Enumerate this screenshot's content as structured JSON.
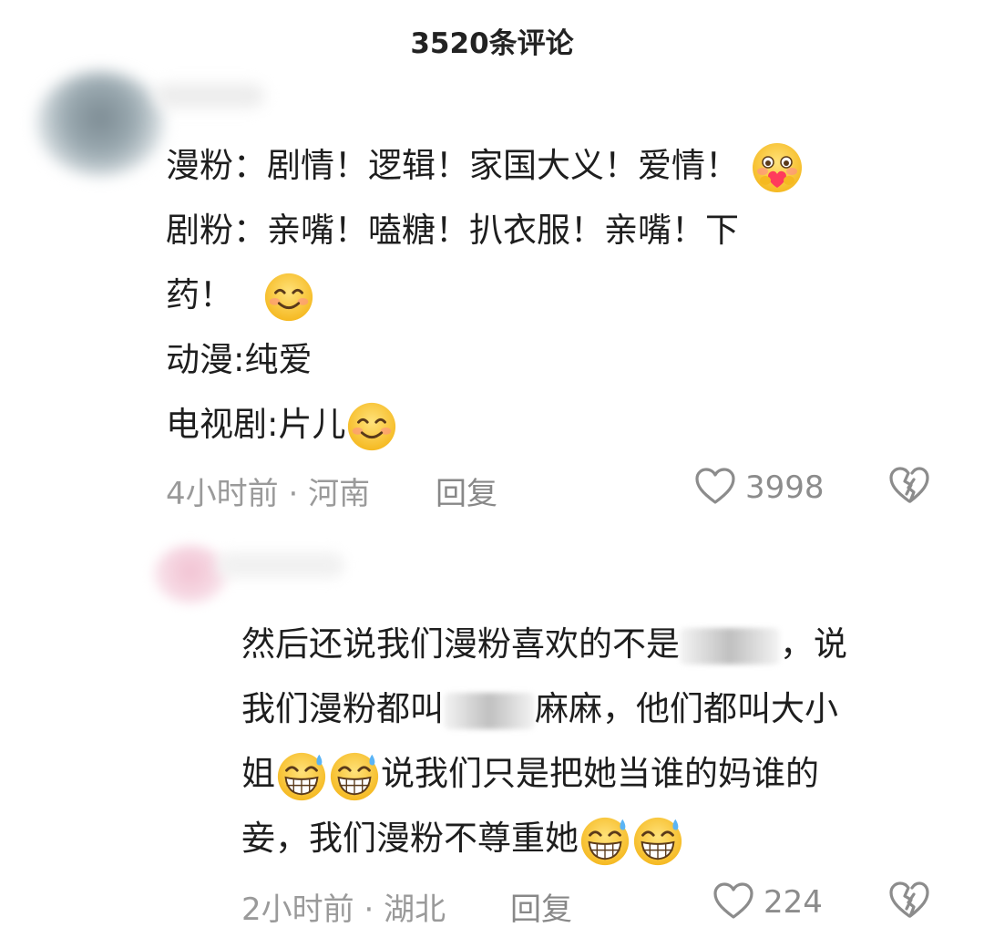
{
  "header": {
    "title": "3520条评论"
  },
  "comments": [
    {
      "lines": [
        "漫粉：剧情！逻辑！家国大义！爱情！",
        "剧粉：亲嘴！嗑糖！扒衣服！亲嘴！下",
        "药！",
        "动漫:纯爱",
        "电视剧:片儿"
      ],
      "time": "4小时前",
      "separator": "·",
      "location": "河南",
      "reply_label": "回复",
      "likes": "3998",
      "emojis": [
        "heart-hug-emoji-icon",
        "smile-emoji-icon",
        "smile-emoji-icon"
      ]
    },
    {
      "line1": "然后还说我们漫粉喜欢的不是",
      "line1_tail": "，说",
      "line2a": "我们漫粉都叫",
      "line2b": "麻麻，他们都叫大小",
      "line3a": "姐",
      "line3b": "说我们只是把她当谁的妈谁的",
      "line4": "妾，我们漫粉不尊重她",
      "time": "2小时前",
      "separator": "·",
      "location": "湖北",
      "reply_label": "回复",
      "likes": "224",
      "emojis": [
        "grin-sweat-emoji-icon",
        "grin-sweat-emoji-icon",
        "grin-sweat-emoji-icon",
        "grin-sweat-emoji-icon"
      ]
    }
  ],
  "colors": {
    "text": "#1e1e1e",
    "meta": "#9a9a9a",
    "icon": "#8c8c8c",
    "emoji_face": "#f9c93a"
  }
}
